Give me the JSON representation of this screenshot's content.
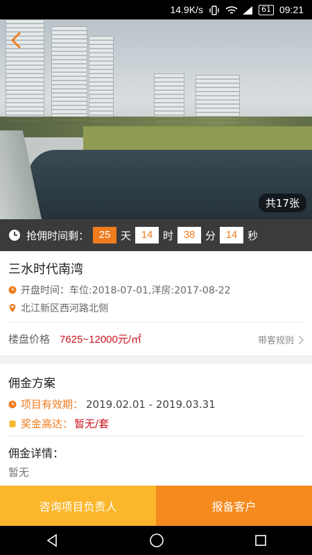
{
  "status_bar": {
    "speed": "14.9K/s",
    "battery": "61",
    "time": "09:21"
  },
  "hero": {
    "photo_count": "共17张"
  },
  "countdown": {
    "label": "抢佣时间剩：",
    "days": "25",
    "days_unit": "天",
    "hours": "14",
    "hours_unit": "时",
    "minutes": "38",
    "minutes_unit": "分",
    "seconds": "14",
    "seconds_unit": "秒"
  },
  "project": {
    "name": "三水时代南湾",
    "opening": "开盘时间：车位:2018-07-01,洋房:2017-08-22",
    "address": "北江新区西河路北侧",
    "price_label": "楼盘价格",
    "price_value": "7625~12000元/㎡",
    "rules_link": "带客规则"
  },
  "commission": {
    "title": "佣金方案",
    "validity_label": "项目有效期：",
    "validity_value": "2019.02.01 - 2019.03.31",
    "bonus_label": "奖金高达：",
    "bonus_value": "暂无/套",
    "detail_label": "佣金详情：",
    "detail_value": "暂无"
  },
  "actions": {
    "consult": "咨询项目负责人",
    "report": "报备客户"
  },
  "colors": {
    "accent": "#f07c1e",
    "price": "#c8161d",
    "consult_bg": "#fbb62c",
    "report_bg": "#f58a1f"
  }
}
